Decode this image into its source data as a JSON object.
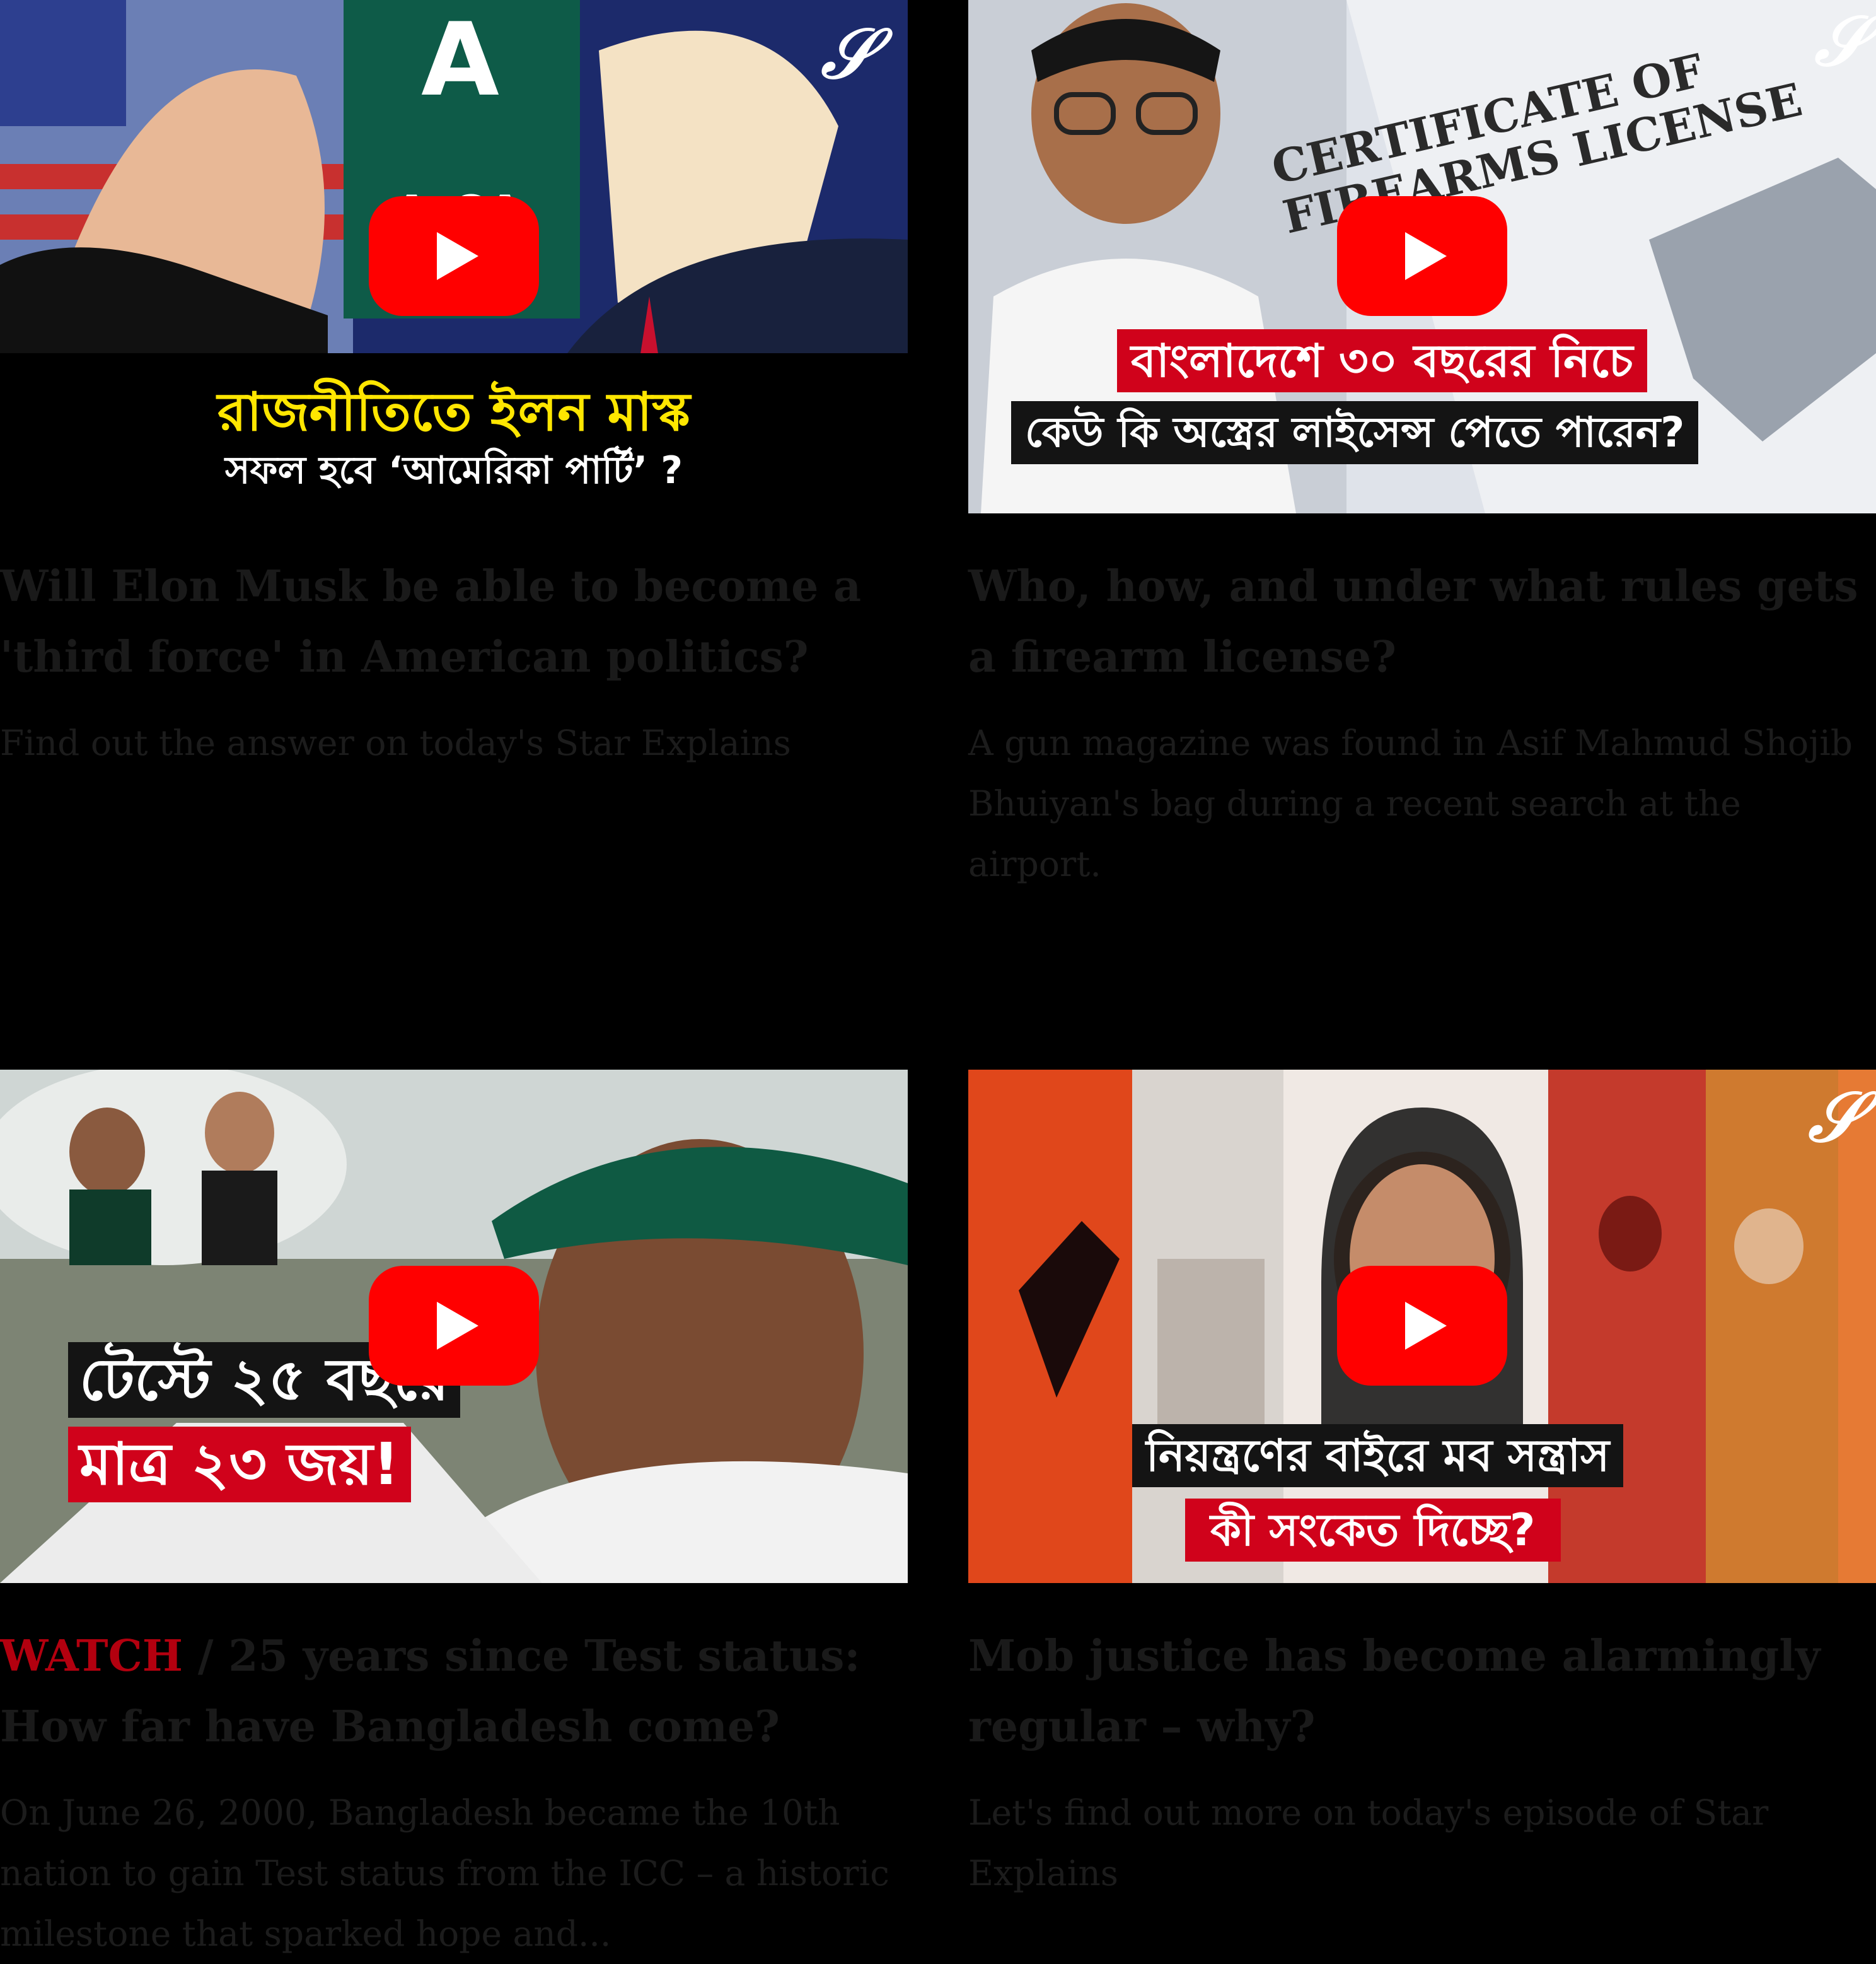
{
  "colors": {
    "background": "#000000",
    "play_button": "#ff0000",
    "watch_tag": "#b3000f",
    "text_muted": "#1a1a1a"
  },
  "icons": {
    "play": "play-icon",
    "logo": "star-logo-icon"
  },
  "cards": [
    {
      "thumb_caption_line1": "রাজনীতিতে ইলন মাস্ক",
      "thumb_caption_line2": "সফল হবে ‘আমেরিকা পার্টি’ ?",
      "title": "Will Elon Musk be able to become a 'third force' in American politics?",
      "summary": "Find out the answer on today's Star Explains"
    },
    {
      "thumb_caption_line1": "বাংলাদেশে ৩০ বছরের নিচে",
      "thumb_caption_line2": "কেউ কি অস্ত্রের লাইসেন্স পেতে পারেন?",
      "thumb_overlay_text": "CERTIFICATE OF FIREARMS LICENSE",
      "title": "Who, how, and under what rules gets a firearm license?",
      "summary": "A gun magazine was found in Asif Mahmud Shojib Bhuiyan's bag during a recent search at the airport."
    },
    {
      "thumb_caption_line1": "টেস্টে ২৫ বছরে",
      "thumb_caption_line2": "মাত্র ২৩ জয়!",
      "tag": "WATCH",
      "tag_separator": " / ",
      "title": "25 years since Test status: How far have Bangladesh come?",
      "summary": "On June 26, 2000, Bangladesh became the 10th nation to gain Test status from the ICC – a historic milestone that sparked hope and..."
    },
    {
      "thumb_caption_line1": "নিয়ন্ত্রণের বাইরে মব সন্ত্রাস",
      "thumb_caption_line2": "কী সংকেত দিচ্ছে?",
      "title": "Mob justice has become alarmingly regular – why?",
      "summary": "Let's find out more on today's episode of Star Explains"
    }
  ]
}
